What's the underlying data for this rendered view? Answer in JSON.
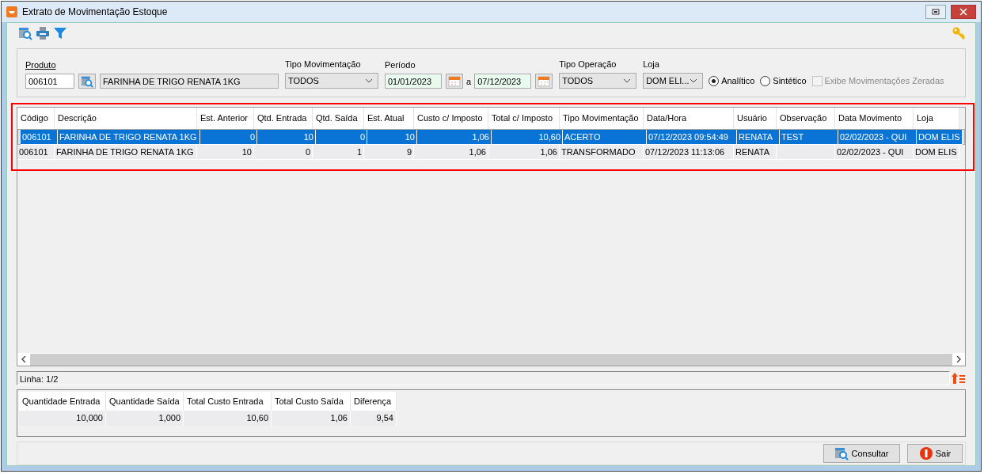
{
  "window": {
    "title": "Extrato de Movimentação Estoque"
  },
  "filters": {
    "produto": {
      "label": "Produto",
      "code": "006101",
      "description": "FARINHA DE TRIGO RENATA 1KG"
    },
    "tipo_movimentacao": {
      "label": "Tipo Movimentação",
      "value": "TODOS"
    },
    "periodo": {
      "label": "Período",
      "from": "01/01/2023",
      "separator": "a",
      "to": "07/12/2023"
    },
    "tipo_operacao": {
      "label": "Tipo Operação",
      "value": "TODOS"
    },
    "loja": {
      "label": "Loja",
      "value": "DOM ELI..."
    },
    "modes": [
      {
        "label": "Analítico",
        "selected": true
      },
      {
        "label": "Sintético",
        "selected": false
      }
    ],
    "exibe_zeradas": {
      "label": "Exibe Movimentações Zeradas",
      "checked": false,
      "disabled": true
    }
  },
  "table": {
    "highlighted": true,
    "columns": [
      {
        "label": "Código",
        "kind": "text"
      },
      {
        "label": "Descrição",
        "kind": "text"
      },
      {
        "label": "Est. Anterior",
        "kind": "number"
      },
      {
        "label": "Qtd. Entrada",
        "kind": "number"
      },
      {
        "label": "Qtd. Saída",
        "kind": "number"
      },
      {
        "label": "Est. Atual",
        "kind": "number"
      },
      {
        "label": "Custo c/ Imposto",
        "kind": "number"
      },
      {
        "label": "Total c/ Imposto",
        "kind": "number"
      },
      {
        "label": "Tipo Movimentação",
        "kind": "text"
      },
      {
        "label": "Data/Hora",
        "kind": "text"
      },
      {
        "label": "Usuário",
        "kind": "text"
      },
      {
        "label": "Observação",
        "kind": "text"
      },
      {
        "label": "Data Movimento",
        "kind": "text"
      },
      {
        "label": "Loja",
        "kind": "text"
      }
    ],
    "rows": [
      {
        "selected": true,
        "cells": [
          "006101",
          "FARINHA DE TRIGO RENATA 1KG",
          "0",
          "10",
          "0",
          "10",
          "1,06",
          "10,60",
          "ACERTO",
          "07/12/2023 09:54:49",
          "RENATA",
          "TEST",
          "02/02/2023 - QUI",
          "DOM ELIS"
        ]
      },
      {
        "selected": false,
        "cells": [
          "006101",
          "FARINHA DE TRIGO RENATA 1KG",
          "10",
          "0",
          "1",
          "9",
          "1,06",
          "1,06",
          "TRANSFORMADO",
          "07/12/2023 11:13:06",
          "RENATA",
          "",
          "02/02/2023 - QUI",
          "DOM ELIS"
        ]
      }
    ]
  },
  "status_line": "Linha: 1/2",
  "summary": {
    "columns": [
      "Quantidade Entrada",
      "Quantidade Saída",
      "Total Custo Entrada",
      "Total Custo Saída",
      "Diferença"
    ],
    "values": [
      "10,000",
      "1,000",
      "10,60",
      "1,06",
      "9,54"
    ]
  },
  "buttons": [
    {
      "label": "Consultar",
      "kind": "search"
    },
    {
      "label": "Sair",
      "kind": "exit"
    }
  ]
}
